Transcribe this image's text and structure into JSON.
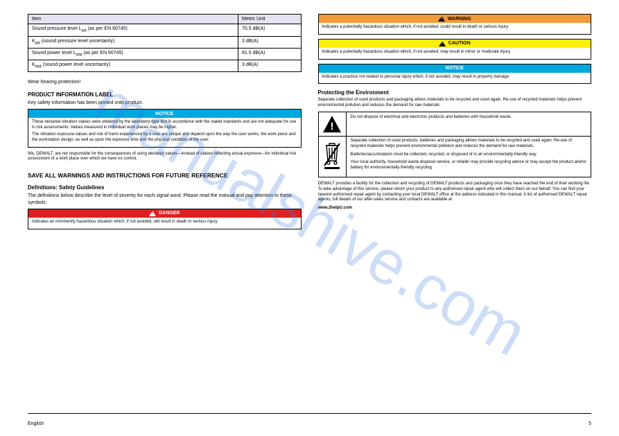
{
  "spec_table": {
    "hdr_item": "Item",
    "hdr_unit": "Metric Unit",
    "rows": [
      [
        "Sound pressure level L<sub>pA</sub>\n(as per EN 60745)",
        "70.5 dB(A)"
      ],
      [
        "K<sub>pA</sub> (sound pressure level uncertainty)",
        "3 dB(A)"
      ],
      [
        "Sound power level L<sub>WA</sub>\n(as per EN 60745)",
        "81.5 dB(A)"
      ],
      [
        "K<sub>WA</sub> (sound power level uncertainty)",
        "3 dB(A)"
      ]
    ]
  },
  "left": {
    "wear_hearing": "Wear hearing protection!",
    "vib_head": "PRODUCT INFORMATION LABEL",
    "vib_p1": "Key safety information has been printed onto product.",
    "notice1": {
      "bar": "NOTICE",
      "lines": [
        "These declared vibration values were obtained by the laboratory-type test in accordance with the stated standards and are not adequate for use in risk assessments. Values measured in individual work places may be higher.",
        "The vibration exposure values and risk of harm experienced by a user are unique and depend upon the way the user works, the work piece and the workstation design, as well as upon the exposure time and the physical condition of the user."
      ]
    },
    "disclaimer": "We, DEWALT, are not responsible for the consequences of using declared values—instead of values reflecting actual exposure—for individual risk assessment of a work place over which we have no control.",
    "safety_heading": "SAVE ALL WARNINGS AND INSTRUCTIONS FOR FUTURE REFERENCE",
    "safety_sub": "Definitions: Safety Guidelines",
    "safety_p": "The definitions below describe the level of severity for each signal word. Please read the manual and pay attention to these symbols.",
    "danger": {
      "bar": "DANGER",
      "body": "Indicates an imminently hazardous situation which, if not avoided, will result in death or serious injury."
    }
  },
  "right": {
    "warning": {
      "bar": "WARNING",
      "body": "Indicates a potentially hazardous situation which, if not avoided, could result in death or serious injury."
    },
    "caution": {
      "bar": "CAUTION",
      "body": "Indicates a potentially hazardous situation which, if not avoided, may result in minor or moderate injury."
    },
    "notice": {
      "bar": "NOTICE",
      "body": "Indicates a practice not related to personal injury which, if not avoided, may result in property damage."
    },
    "env_heading": "Protecting the Environment",
    "env_p": "Separate collection of used products and packaging allows materials to be recycled and used again. Re-use of recycled materials helps prevent environmental pollution and reduces the demand for raw materials.",
    "env_warn": "Do not dispose of electrical and electronic products and batteries with household waste.",
    "env_weee": "Separate collection of used products, batteries and packaging allows materials to be recycled and used again. Re-use of recycled materials helps prevent environmental pollution and reduces the demand for raw materials.",
    "env_note1": "Batteries/accumulators must be collected, recycled, or disposed of in an environmentally-friendly way.",
    "env_note2": "Your local authority, household waste disposal service, or retailer may provide recycling advice or may accept the product and/or battery for environmentally-friendly recycling.",
    "env_bullets_intro": "DEWALT provides a facility for the collection and recycling of DEWALT products and packaging once they have reached the end of their working life. To take advantage of this service, please return your product to any authorised repair agent who will collect them on our behalf. You can find your nearest authorised repair agent by contacting your local DEWALT office at the address indicated in this manual. A list of authorised DEWALT repair agents, full details of our after-sales service and contacts are available at:",
    "env_url": "www.2helpU.com"
  },
  "footer": {
    "left": "English",
    "right": "5"
  },
  "watermark": "manualshive.com"
}
